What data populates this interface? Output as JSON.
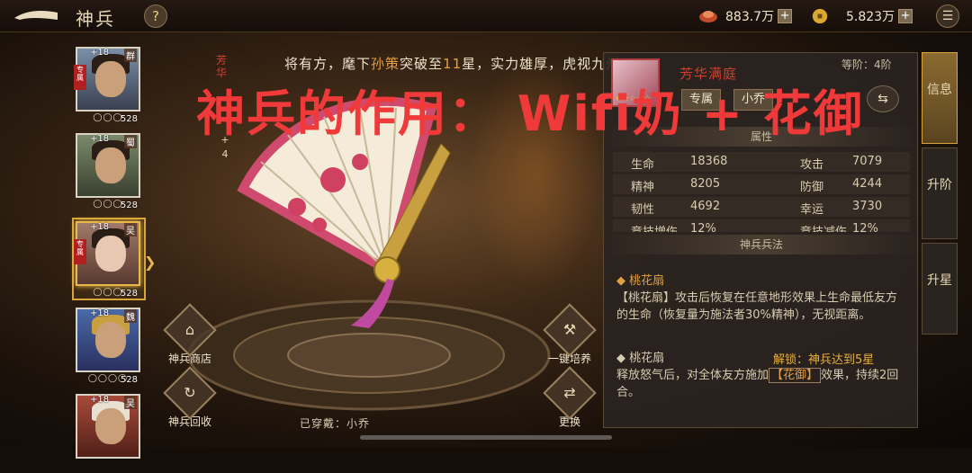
{
  "header": {
    "title": "神兵",
    "help": "?",
    "menu": "☰"
  },
  "resources": [
    {
      "value": "883.7万",
      "plus": "+"
    },
    {
      "value": "5.823万",
      "plus": "+"
    }
  ],
  "heroes": [
    {
      "level": "+18",
      "faction": "群",
      "power": "528",
      "tag": "专属",
      "stars": "◯◯◯"
    },
    {
      "level": "+18",
      "faction": "蜀",
      "power": "528",
      "tag": "",
      "stars": "◯◯◯"
    },
    {
      "level": "+18",
      "faction": "吴",
      "power": "528",
      "tag": "专属",
      "stars": "◯◯◯",
      "selected": true
    },
    {
      "level": "+18",
      "faction": "魏",
      "power": "528",
      "tag": "",
      "stars": "◯◯◯◯"
    },
    {
      "level": "+18",
      "faction": "吴",
      "power": "",
      "tag": "",
      "stars": ""
    }
  ],
  "weapon_tag": "芳华",
  "plus_level": "+\n4",
  "notice": {
    "pre": "将有方，麾下",
    "name": "孙策",
    "mid": "突破至",
    "stars": "11",
    "post": "星，实力雄厚，虎视九州！"
  },
  "overlay": "神兵的作用： Wifi奶 + 花御",
  "actions": {
    "shop": "神兵商店",
    "recycle": "神兵回收",
    "train": "一键培养",
    "replace": "更换"
  },
  "wearing": "已穿戴：小乔",
  "panel": {
    "weapon_name": "芳华满庭",
    "grade": "等阶：4阶",
    "stars": "★★☆☆☆",
    "btn_exclusive": "专属",
    "btn_other": "小乔",
    "attr_title": "属性",
    "attrs": [
      {
        "l": "生命",
        "v": "18368",
        "r": "攻击",
        "rv": "7079"
      },
      {
        "l": "精神",
        "v": "8205",
        "r": "防御",
        "rv": "4244"
      },
      {
        "l": "韧性",
        "v": "4692",
        "r": "幸运",
        "rv": "3730"
      },
      {
        "l": "竞技增伤",
        "v": "12%",
        "r": "竞技减伤",
        "rv": "12%"
      }
    ],
    "skill_title": "神兵兵法",
    "skill1_name": "◆ 桃花扇",
    "skill1_desc": "【桃花扇】攻击后恢复在任意地形效果上生命最低友方的生命（恢复量为施法者30%精神），无视距离。",
    "skill2_name": "◆ 桃花扇",
    "skill2_unlock": "解锁：神兵达到5星",
    "skill2_pre": "释放怒气后，对全体友方施加",
    "skill2_box": "【花御】",
    "skill2_post": "效果，持续2回合。"
  },
  "tabs": [
    "信息",
    "升阶",
    "升星"
  ]
}
